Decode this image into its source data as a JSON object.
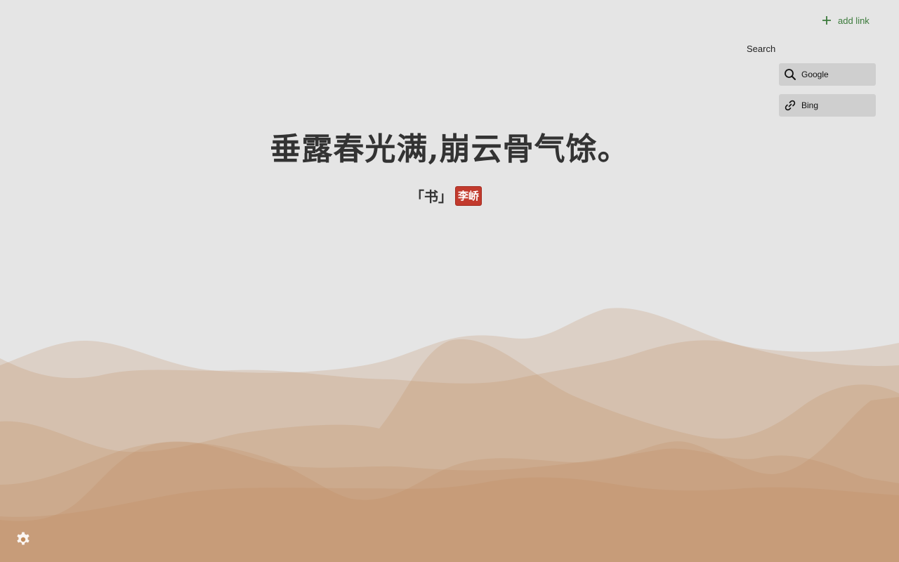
{
  "header": {
    "add_link_label": "add link",
    "accent_color": "#3b7a3b"
  },
  "links": {
    "section_title": "Search",
    "items": [
      {
        "label": "Google",
        "icon": "search-icon"
      },
      {
        "label": "Bing",
        "icon": "link-icon"
      }
    ]
  },
  "poem": {
    "line": "垂露春光满,崩云骨气馀。",
    "work": "「书」",
    "author": "李峤",
    "seal_color": "#c23a2d"
  },
  "footer": {
    "settings_icon": "gear-icon"
  },
  "theme": {
    "background": "#e5e5e5",
    "wave_color": "#c08a5a"
  }
}
